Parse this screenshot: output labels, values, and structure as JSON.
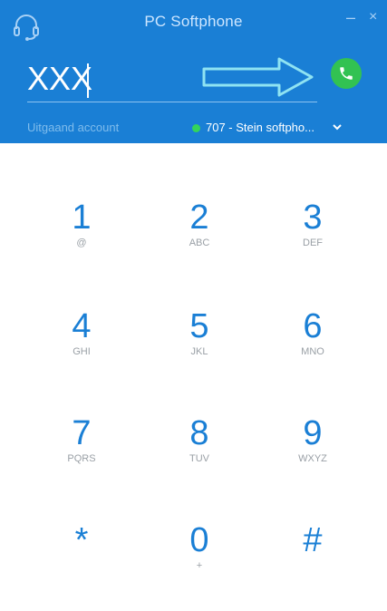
{
  "window": {
    "title": "PC Softphone",
    "minimize_label": "–",
    "close_label": "×"
  },
  "dialer": {
    "number_value": "XXX",
    "account_label": "Uitgaand account",
    "account_value": "707 - Stein softpho...",
    "account_status_color": "#33d45a"
  },
  "colors": {
    "header": "#1a7fd5",
    "call_button": "#32c252",
    "digit": "#1a7fd5"
  },
  "keypad": {
    "keys": [
      {
        "digit": "1",
        "letters": "@"
      },
      {
        "digit": "2",
        "letters": "ABC"
      },
      {
        "digit": "3",
        "letters": "DEF"
      },
      {
        "digit": "4",
        "letters": "GHI"
      },
      {
        "digit": "5",
        "letters": "JKL"
      },
      {
        "digit": "6",
        "letters": "MNO"
      },
      {
        "digit": "7",
        "letters": "PQRS"
      },
      {
        "digit": "8",
        "letters": "TUV"
      },
      {
        "digit": "9",
        "letters": "WXYZ"
      },
      {
        "digit": "*",
        "letters": ""
      },
      {
        "digit": "0",
        "letters": "+"
      },
      {
        "digit": "#",
        "letters": ""
      }
    ]
  },
  "icons": {
    "app": "headset-icon",
    "call": "phone-icon",
    "arrow": "arrow-right-icon",
    "dropdown": "chevron-down-icon"
  }
}
